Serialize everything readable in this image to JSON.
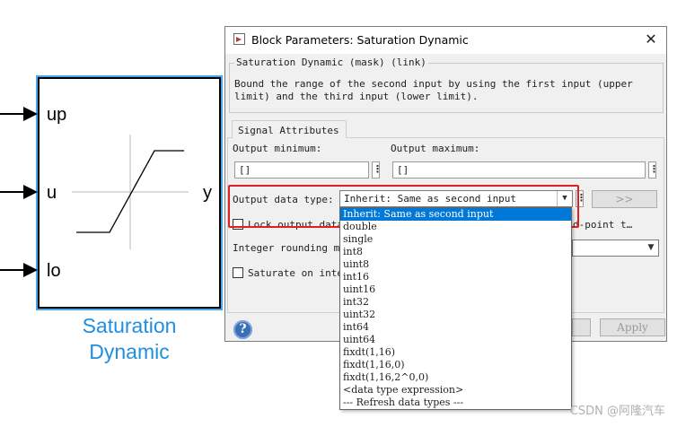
{
  "canvas": {
    "ports_in": [
      "up",
      "u",
      "lo"
    ],
    "port_out": "y",
    "block_caption_lines": [
      "Saturation",
      "Dynamic"
    ],
    "block_highlight_color": "#45a6ee",
    "caption_color": "#1f8fdf"
  },
  "dialog": {
    "title": "Block Parameters: Saturation Dynamic",
    "close_icon": "close-icon",
    "group_title": "Saturation Dynamic (mask) (link)",
    "description_line1": "Bound the range of the second input by using the first input (upper",
    "description_line2": "limit) and the third input (lower limit).",
    "tab_label": "Signal Attributes",
    "output_min_label": "Output minimum:",
    "output_min_value": "[]",
    "output_max_label": "Output maximum:",
    "output_max_value": "[]",
    "output_type_label": "Output data type:",
    "output_type_value": "Inherit: Same as second input",
    "assistant_button": ">>",
    "lock_label": "Lock output data",
    "fixed_point_text": "d-point t…",
    "rounding_label": "Integer rounding mo",
    "saturate_label": "Saturate on inte",
    "apply_button": "Apply"
  },
  "dropdown": {
    "selected_index": 0,
    "options": [
      "Inherit: Same as second input",
      "double",
      "single",
      "int8",
      "uint8",
      "int16",
      "uint16",
      "int32",
      "uint32",
      "int64",
      "uint64",
      "fixdt(1,16)",
      "fixdt(1,16,0)",
      "fixdt(1,16,2^0,0)",
      "<data type expression>",
      "--- Refresh data types ---"
    ]
  },
  "highlight_color": "#e02020",
  "watermark": "CSDN @阿隆汽车"
}
